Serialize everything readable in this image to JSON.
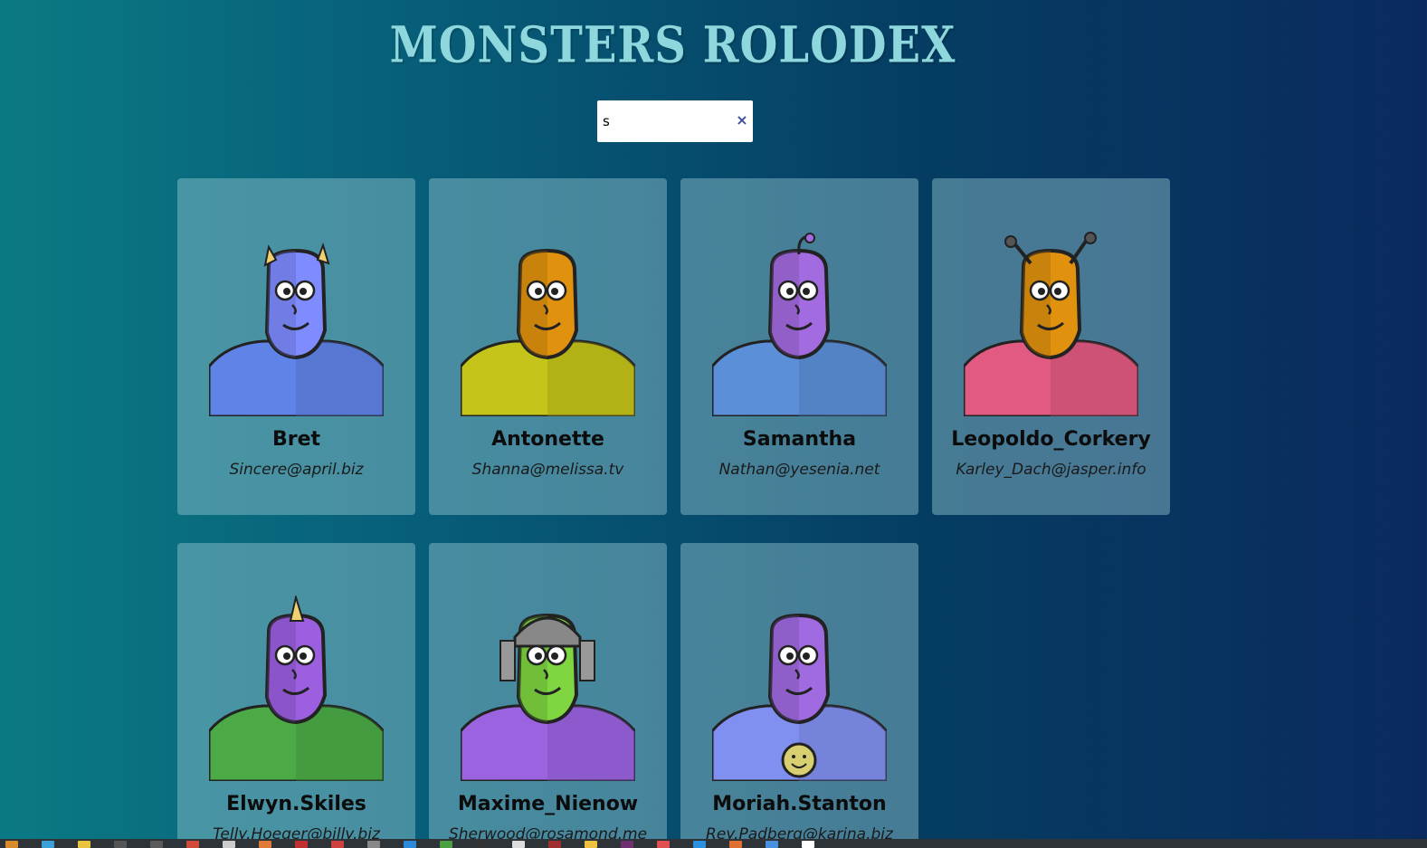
{
  "app": {
    "title": "MONSTERS ROLODEX"
  },
  "search": {
    "value": "s",
    "clear_label": "×"
  },
  "monsters": [
    {
      "name": "Bret",
      "email": "Sincere@april.biz",
      "skin": "#7f8cff",
      "shirt": "#5f83e6",
      "feature": "horns"
    },
    {
      "name": "Antonette",
      "email": "Shanna@melissa.tv",
      "skin": "#e0920f",
      "shirt": "#c4c41a",
      "feature": "none"
    },
    {
      "name": "Samantha",
      "email": "Nathan@yesenia.net",
      "skin": "#a36be0",
      "shirt": "#5b8fd8",
      "feature": "antenna"
    },
    {
      "name": "Leopoldo_Corkery",
      "email": "Karley_Dach@jasper.info",
      "skin": "#e0920f",
      "shirt": "#e05a82",
      "feature": "antennae"
    },
    {
      "name": "Elwyn.Skiles",
      "email": "Telly.Hoeger@billy.biz",
      "skin": "#9b5fe0",
      "shirt": "#4caa46",
      "feature": "horn"
    },
    {
      "name": "Maxime_Nienow",
      "email": "Sherwood@rosamond.me",
      "skin": "#7fd640",
      "shirt": "#9b63e0",
      "feature": "helmet"
    },
    {
      "name": "Moriah.Stanton",
      "email": "Rey.Padberg@karina.biz",
      "skin": "#a06be0",
      "shirt": "#8090f0",
      "feature": "smiley"
    }
  ],
  "taskbar": {
    "icons": [
      "#d98a2b",
      "#3aa0d8",
      "#e8c440",
      "#555555",
      "#5a5a5a",
      "#d04a3a",
      "#cccccc",
      "#e07a3a",
      "#c03030",
      "#d04040",
      "#888888",
      "#2d8ad8",
      "#4aa040",
      "#333333",
      "#dddddd",
      "#a03030",
      "#f0c040",
      "#703070",
      "#e05050",
      "#2a90e0",
      "#e07030",
      "#4a90e0",
      "#ffffff"
    ]
  }
}
